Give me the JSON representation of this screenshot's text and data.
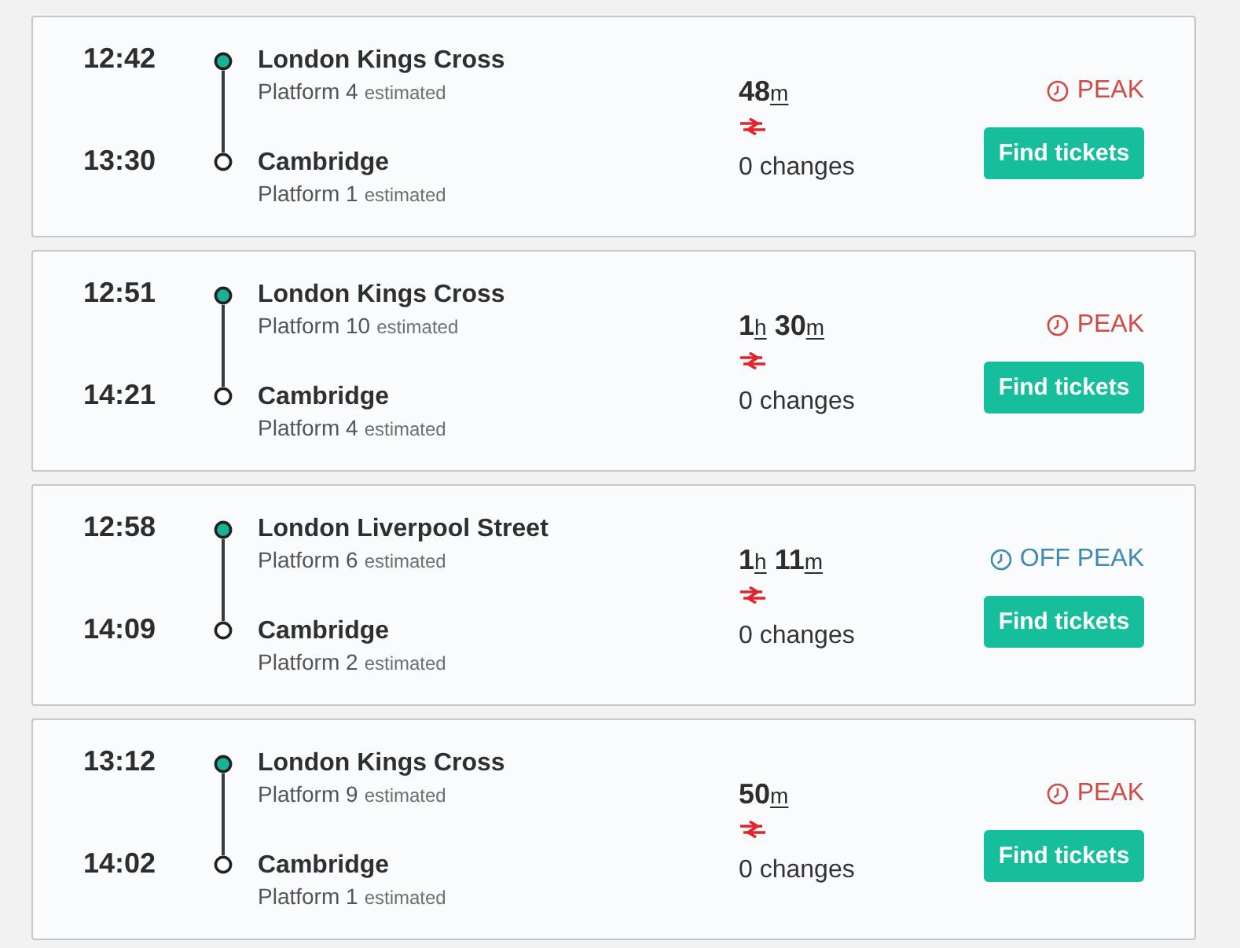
{
  "journeys": [
    {
      "departure": {
        "time": "12:42",
        "station": "London Kings Cross",
        "platform": "Platform 4",
        "status": "estimated"
      },
      "arrival": {
        "time": "13:30",
        "station": "Cambridge",
        "platform": "Platform 1",
        "status": "estimated"
      },
      "duration": [
        {
          "number": "48",
          "unit": "m"
        }
      ],
      "changes": "0 changes",
      "fare": {
        "kind": "peak",
        "label": "PEAK"
      },
      "button": "Find tickets"
    },
    {
      "departure": {
        "time": "12:51",
        "station": "London Kings Cross",
        "platform": "Platform 10",
        "status": "estimated"
      },
      "arrival": {
        "time": "14:21",
        "station": "Cambridge",
        "platform": "Platform 4",
        "status": "estimated"
      },
      "duration": [
        {
          "number": "1",
          "unit": "h"
        },
        {
          "number": "30",
          "unit": "m"
        }
      ],
      "changes": "0 changes",
      "fare": {
        "kind": "peak",
        "label": "PEAK"
      },
      "button": "Find tickets"
    },
    {
      "departure": {
        "time": "12:58",
        "station": "London Liverpool Street",
        "platform": "Platform 6",
        "status": "estimated"
      },
      "arrival": {
        "time": "14:09",
        "station": "Cambridge",
        "platform": "Platform 2",
        "status": "estimated"
      },
      "duration": [
        {
          "number": "1",
          "unit": "h"
        },
        {
          "number": "11",
          "unit": "m"
        }
      ],
      "changes": "0 changes",
      "fare": {
        "kind": "off_peak",
        "label": "OFF PEAK"
      },
      "button": "Find tickets"
    },
    {
      "departure": {
        "time": "13:12",
        "station": "London Kings Cross",
        "platform": "Platform 9",
        "status": "estimated"
      },
      "arrival": {
        "time": "14:02",
        "station": "Cambridge",
        "platform": "Platform 1",
        "status": "estimated"
      },
      "duration": [
        {
          "number": "50",
          "unit": "m"
        }
      ],
      "changes": "0 changes",
      "fare": {
        "kind": "peak",
        "label": "PEAK"
      },
      "button": "Find tickets"
    }
  ]
}
